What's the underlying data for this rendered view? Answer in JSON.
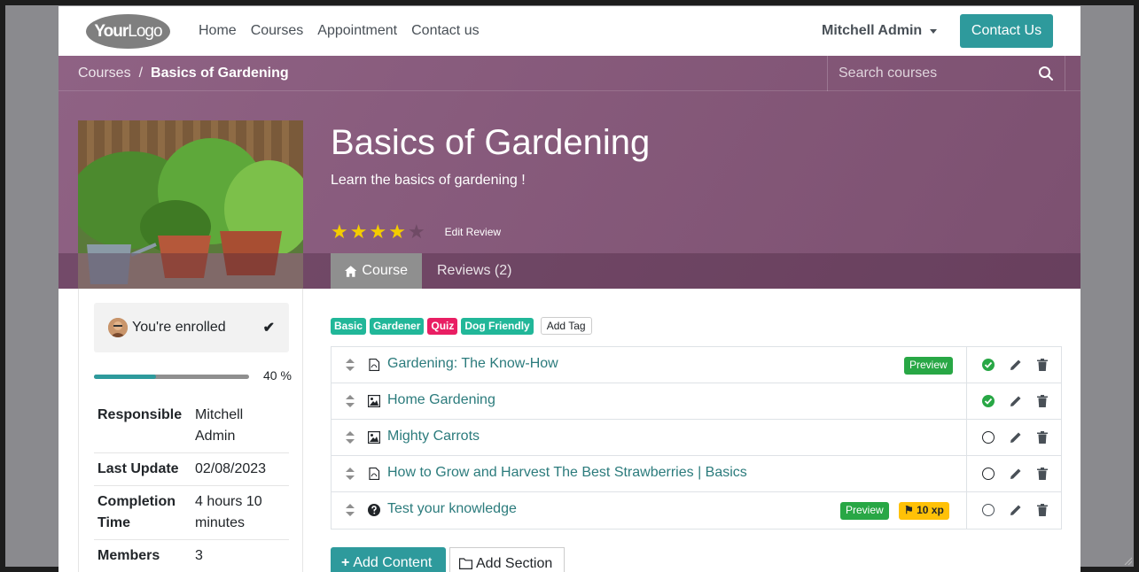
{
  "navbar": {
    "logo_your": "Your",
    "logo_logo": "Logo",
    "links": [
      "Home",
      "Courses",
      "Appointment",
      "Contact us"
    ],
    "user": "Mitchell Admin",
    "contact_button": "Contact Us"
  },
  "breadcrumb": {
    "parent": "Courses",
    "separator": "/",
    "current": "Basics of Gardening"
  },
  "search": {
    "placeholder": "Search courses"
  },
  "course": {
    "title": "Basics of Gardening",
    "subtitle": "Learn the basics of gardening !",
    "rating": 4,
    "rating_max": 5,
    "edit_review": "Edit Review"
  },
  "tabs": {
    "course": "Course",
    "reviews": "Reviews (2)"
  },
  "sidebar": {
    "enrolled": "You're enrolled",
    "progress_percent": 40,
    "progress_label": "40 %",
    "info": {
      "responsible_label": "Responsible",
      "responsible_value": "Mitchell Admin",
      "last_update_label": "Last Update",
      "last_update_value": "02/08/2023",
      "completion_label": "Completion Time",
      "completion_value": "4 hours 10 minutes",
      "members_label": "Members",
      "members_value": "3"
    }
  },
  "tags": {
    "basic": "Basic",
    "gardener": "Gardener",
    "quiz": "Quiz",
    "dog_friendly": "Dog Friendly",
    "add_tag": "Add Tag"
  },
  "slides": {
    "s0": {
      "title": "Gardening: The Know-How",
      "type": "pdf-icon",
      "badge": "Preview",
      "done": true
    },
    "s1": {
      "title": "Home Gardening",
      "type": "image-icon",
      "done": true
    },
    "s2": {
      "title": "Mighty Carrots",
      "type": "image-icon",
      "done": false
    },
    "s3": {
      "title": "How to Grow and Harvest The Best Strawberries | Basics",
      "type": "pdf-icon",
      "done": false
    },
    "s4": {
      "title": "Test your knowledge",
      "type": "question-icon",
      "badge": "Preview",
      "xp": "10 xp",
      "done": false
    }
  },
  "actions": {
    "add_content": "Add Content",
    "add_section": "Add Section"
  },
  "colors": {
    "hero": "#875a7b",
    "accent": "#2e9a9c",
    "link": "#2b7b7c",
    "preview": "#28a745",
    "xp": "#ffc107"
  }
}
